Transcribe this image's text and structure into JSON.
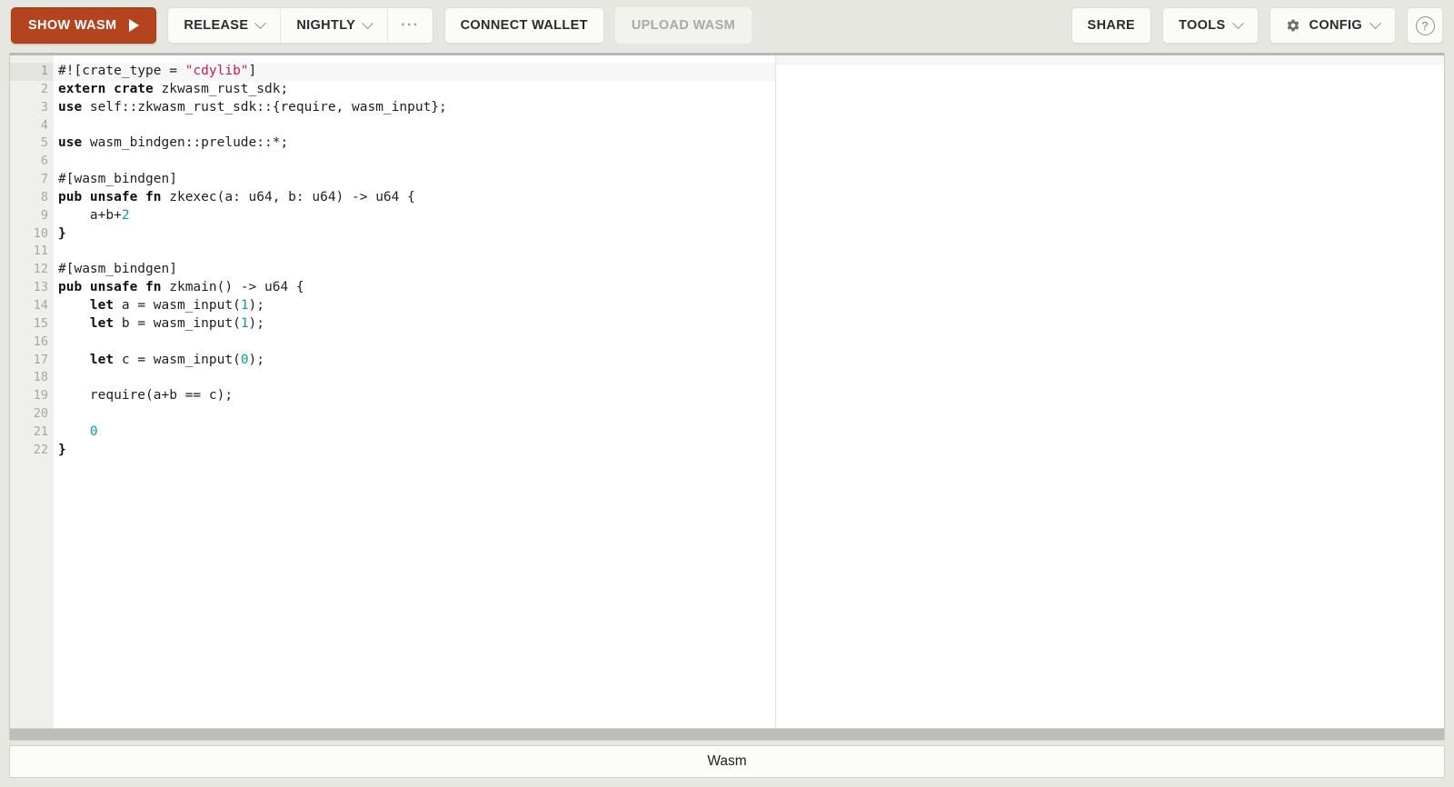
{
  "toolbar": {
    "show_wasm": {
      "label": "SHOW WASM",
      "icon": "play-icon",
      "accent": "#b3441e"
    },
    "release": {
      "label": "RELEASE",
      "icon": "chevron-down-icon"
    },
    "nightly": {
      "label": "NIGHTLY",
      "icon": "chevron-down-icon"
    },
    "more": {
      "label": "···",
      "icon": "ellipsis-icon"
    },
    "connect_wallet": {
      "label": "CONNECT WALLET"
    },
    "upload_wasm": {
      "label": "UPLOAD WASM",
      "disabled": true
    },
    "share": {
      "label": "SHARE"
    },
    "tools": {
      "label": "TOOLS",
      "icon": "chevron-down-icon"
    },
    "config": {
      "label": "CONFIG",
      "icon": "gear-icon"
    },
    "help": {
      "label": "?",
      "icon": "question-circle-icon"
    }
  },
  "editor": {
    "language": "rust",
    "active_line": 1,
    "fold_lines": [
      8,
      13
    ],
    "colors": {
      "string": "#d3175c",
      "number": "#0b9ba6",
      "keyword": "#111111",
      "text": "#1f1f1f",
      "gutter_bg": "#efefed",
      "gutter_text": "#a6a6a2"
    },
    "lines": [
      {
        "n": 1,
        "tokens": [
          {
            "t": "#![crate_type = ",
            "c": "p"
          },
          {
            "t": "\"cdylib\"",
            "c": "s"
          },
          {
            "t": "]",
            "c": "p"
          }
        ]
      },
      {
        "n": 2,
        "tokens": [
          {
            "t": "extern crate",
            "c": "k"
          },
          {
            "t": " zkwasm_rust_sdk;",
            "c": "p"
          }
        ]
      },
      {
        "n": 3,
        "tokens": [
          {
            "t": "use",
            "c": "k"
          },
          {
            "t": " self::zkwasm_rust_sdk::{require, wasm_input};",
            "c": "p"
          }
        ]
      },
      {
        "n": 4,
        "tokens": [
          {
            "t": "",
            "c": "p"
          }
        ]
      },
      {
        "n": 5,
        "tokens": [
          {
            "t": "use",
            "c": "k"
          },
          {
            "t": " wasm_bindgen::prelude::*;",
            "c": "p"
          }
        ]
      },
      {
        "n": 6,
        "tokens": [
          {
            "t": "",
            "c": "p"
          }
        ]
      },
      {
        "n": 7,
        "tokens": [
          {
            "t": "#[wasm_bindgen]",
            "c": "p"
          }
        ]
      },
      {
        "n": 8,
        "tokens": [
          {
            "t": "pub unsafe fn",
            "c": "k"
          },
          {
            "t": " zkexec(a: u64, b: u64) -> u64 {",
            "c": "p"
          }
        ]
      },
      {
        "n": 9,
        "tokens": [
          {
            "t": "    a+b+",
            "c": "p"
          },
          {
            "t": "2",
            "c": "n"
          }
        ]
      },
      {
        "n": 10,
        "tokens": [
          {
            "t": "}",
            "c": "k"
          }
        ]
      },
      {
        "n": 11,
        "tokens": [
          {
            "t": "",
            "c": "p"
          }
        ]
      },
      {
        "n": 12,
        "tokens": [
          {
            "t": "#[wasm_bindgen]",
            "c": "p"
          }
        ]
      },
      {
        "n": 13,
        "tokens": [
          {
            "t": "pub unsafe fn",
            "c": "k"
          },
          {
            "t": " zkmain() -> u64 {",
            "c": "p"
          }
        ]
      },
      {
        "n": 14,
        "tokens": [
          {
            "t": "    ",
            "c": "p"
          },
          {
            "t": "let",
            "c": "k"
          },
          {
            "t": " a = wasm_input(",
            "c": "p"
          },
          {
            "t": "1",
            "c": "n"
          },
          {
            "t": ");",
            "c": "p"
          }
        ]
      },
      {
        "n": 15,
        "tokens": [
          {
            "t": "    ",
            "c": "p"
          },
          {
            "t": "let",
            "c": "k"
          },
          {
            "t": " b = wasm_input(",
            "c": "p"
          },
          {
            "t": "1",
            "c": "n"
          },
          {
            "t": ");",
            "c": "p"
          }
        ]
      },
      {
        "n": 16,
        "tokens": [
          {
            "t": "",
            "c": "p"
          }
        ]
      },
      {
        "n": 17,
        "tokens": [
          {
            "t": "    ",
            "c": "p"
          },
          {
            "t": "let",
            "c": "k"
          },
          {
            "t": " c = wasm_input(",
            "c": "p"
          },
          {
            "t": "0",
            "c": "n"
          },
          {
            "t": ");",
            "c": "p"
          }
        ]
      },
      {
        "n": 18,
        "tokens": [
          {
            "t": "",
            "c": "p"
          }
        ]
      },
      {
        "n": 19,
        "tokens": [
          {
            "t": "    require(a+b == c);",
            "c": "p"
          }
        ]
      },
      {
        "n": 20,
        "tokens": [
          {
            "t": "",
            "c": "p"
          }
        ]
      },
      {
        "n": 21,
        "tokens": [
          {
            "t": "    ",
            "c": "p"
          },
          {
            "t": "0",
            "c": "n"
          }
        ]
      },
      {
        "n": 22,
        "tokens": [
          {
            "t": "}",
            "c": "k"
          }
        ]
      }
    ]
  },
  "output_pane": {
    "content": ""
  },
  "statusbar": {
    "label": "Wasm"
  }
}
